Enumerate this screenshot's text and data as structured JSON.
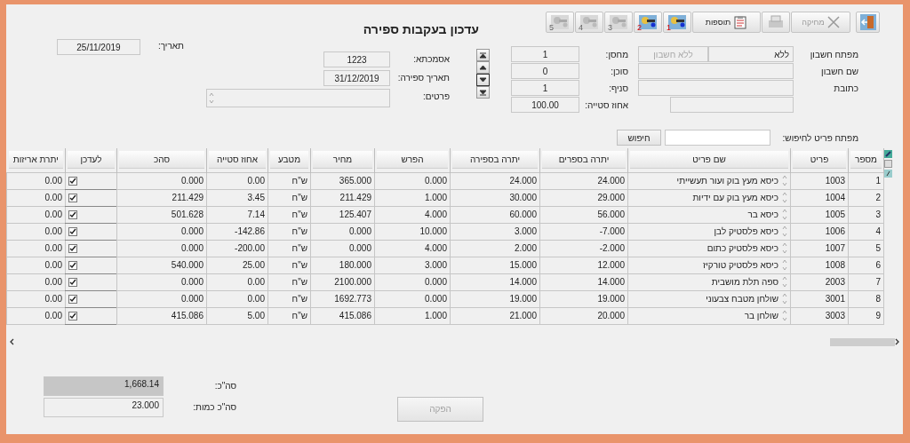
{
  "window": {
    "title": "עדכון בעקבות ספירה"
  },
  "toolbar": [
    {
      "kind": "exit",
      "disabled": false
    },
    {
      "kind": "delete",
      "label": "מחיקה",
      "disabled": true
    },
    {
      "kind": "print",
      "disabled": true
    },
    {
      "kind": "extras",
      "label": "תוספות",
      "disabled": false
    },
    {
      "kind": "key",
      "label": "1",
      "disabled": false
    },
    {
      "kind": "key",
      "label": "2",
      "disabled": false
    },
    {
      "kind": "key",
      "label": "3",
      "disabled": true
    },
    {
      "kind": "key",
      "label": "4",
      "disabled": true
    },
    {
      "kind": "key",
      "label": "5",
      "disabled": true
    }
  ],
  "date": {
    "label": "תאריך:",
    "value": "25/11/2019"
  },
  "document": [
    {
      "kind": "field",
      "label": "אסמכתא:",
      "value": "1223"
    },
    {
      "kind": "field",
      "label": "תאריך ספירה:",
      "value": "31/12/2019"
    },
    {
      "kind": "memo",
      "label": "פרטים:"
    }
  ],
  "navigation": [
    {
      "kind": "first",
      "focused": false
    },
    {
      "kind": "previous",
      "focused": false
    },
    {
      "kind": "next",
      "focused": true
    },
    {
      "kind": "last",
      "focused": false
    }
  ],
  "warehouse": [
    {
      "label": "מחסן:",
      "value": "1"
    },
    {
      "label": "סוכן:",
      "value": "0"
    },
    {
      "label": "סניף:",
      "value": "1"
    },
    {
      "label": "אחוז סטייה:",
      "value": "100.00"
    }
  ],
  "account": [
    {
      "label": "מפתח חשבון",
      "value": "ללא",
      "linked": {
        "value": "ללא חשבון",
        "disabled": true
      }
    },
    {
      "label": "שם חשבון"
    },
    {
      "label": "כתובת"
    }
  ],
  "search": {
    "label": "מפתח פריט לחיפוש:",
    "button": "חיפוש"
  },
  "table": {
    "columns": [
      {
        "label": "מספר",
        "kind": "text"
      },
      {
        "label": "פריט",
        "kind": "text"
      },
      {
        "label": "שם פריט",
        "kind": "name"
      },
      {
        "label": "יתרה בספרים",
        "kind": "text"
      },
      {
        "label": "יתרה בספירה",
        "kind": "text"
      },
      {
        "label": "הפרש",
        "kind": "text"
      },
      {
        "label": "מחיר",
        "kind": "text"
      },
      {
        "label": "מטבע",
        "kind": "currency"
      },
      {
        "label": "אחוז סטייה",
        "kind": "text"
      },
      {
        "label": "סהכ",
        "kind": "text"
      },
      {
        "label": "לעדכן",
        "kind": "check"
      },
      {
        "label": "יתרת אריזות",
        "kind": "text"
      }
    ],
    "rows": [
      {
        "cells": [
          "1",
          "1003",
          "כיסא מעץ בוק ועור תעשייתי",
          "24.000",
          "24.000",
          "0.000",
          "365.000",
          "ש\"ח",
          "0.00",
          "0.000",
          "0.00"
        ],
        "update": true
      },
      {
        "cells": [
          "2",
          "1004",
          "כיסא מעץ בוק עם ידיות",
          "29.000",
          "30.000",
          "1.000",
          "211.429",
          "ש\"ח",
          "3.45",
          "211.429",
          "0.00"
        ],
        "update": true
      },
      {
        "cells": [
          "3",
          "1005",
          "כיסא בר",
          "56.000",
          "60.000",
          "4.000",
          "125.407",
          "ש\"ח",
          "7.14",
          "501.628",
          "0.00"
        ],
        "update": true
      },
      {
        "cells": [
          "4",
          "1006",
          "כיסא פלסטיק לבן",
          "-7.000",
          "3.000",
          "10.000",
          "0.000",
          "ש\"ח",
          "-142.86",
          "0.000",
          "0.00"
        ],
        "update": true
      },
      {
        "cells": [
          "5",
          "1007",
          "כיסא פלסטיק כתום",
          "-2.000",
          "2.000",
          "4.000",
          "0.000",
          "ש\"ח",
          "-200.00",
          "0.000",
          "0.00"
        ],
        "update": true
      },
      {
        "cells": [
          "6",
          "1008",
          "כיסא פלסטיק טורקיז",
          "12.000",
          "15.000",
          "3.000",
          "180.000",
          "ש\"ח",
          "25.00",
          "540.000",
          "0.00"
        ],
        "update": true
      },
      {
        "cells": [
          "7",
          "2003",
          "ספה תלת מושבית",
          "14.000",
          "14.000",
          "0.000",
          "2100.000",
          "ש\"ח",
          "0.00",
          "0.000",
          "0.00"
        ],
        "update": true
      },
      {
        "cells": [
          "8",
          "3001",
          "שולחן מטבח צבעוני",
          "19.000",
          "19.000",
          "0.000",
          "1692.773",
          "ש\"ח",
          "0.00",
          "0.000",
          "0.00"
        ],
        "update": true
      },
      {
        "cells": [
          "9",
          "3003",
          "שולחן בר",
          "20.000",
          "21.000",
          "1.000",
          "415.086",
          "ש\"ח",
          "5.00",
          "415.086",
          "0.00"
        ],
        "update": true
      }
    ]
  },
  "totals": [
    {
      "label": "סה\"כ:",
      "value": "1,668.14",
      "highlighted": true
    },
    {
      "label": "סה\"כ כמות:",
      "value": "23.000",
      "highlighted": false
    }
  ],
  "produce_button": {
    "label": "הפקה",
    "disabled": true
  }
}
